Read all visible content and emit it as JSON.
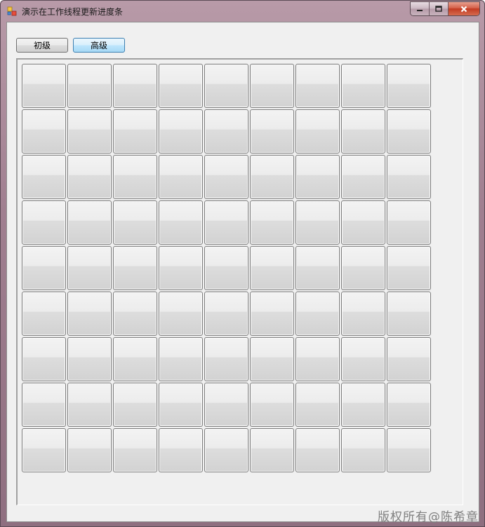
{
  "window": {
    "title": "演示在工作线程更新进度条",
    "icon": "winforms-app-icon",
    "buttons": {
      "minimize": "minimize-icon",
      "maximize": "maximize-icon",
      "close": "close-icon"
    }
  },
  "toolbar": {
    "beginner_label": "初级",
    "advanced_label": "高级"
  },
  "grid": {
    "rows": 9,
    "columns": 9
  },
  "watermark": "版权所有@陈希章",
  "colors": {
    "title_bar": "#a07f90",
    "client": "#f0f0f0",
    "focus_border": "#3c7fb1",
    "close_button": "#c23b22"
  }
}
